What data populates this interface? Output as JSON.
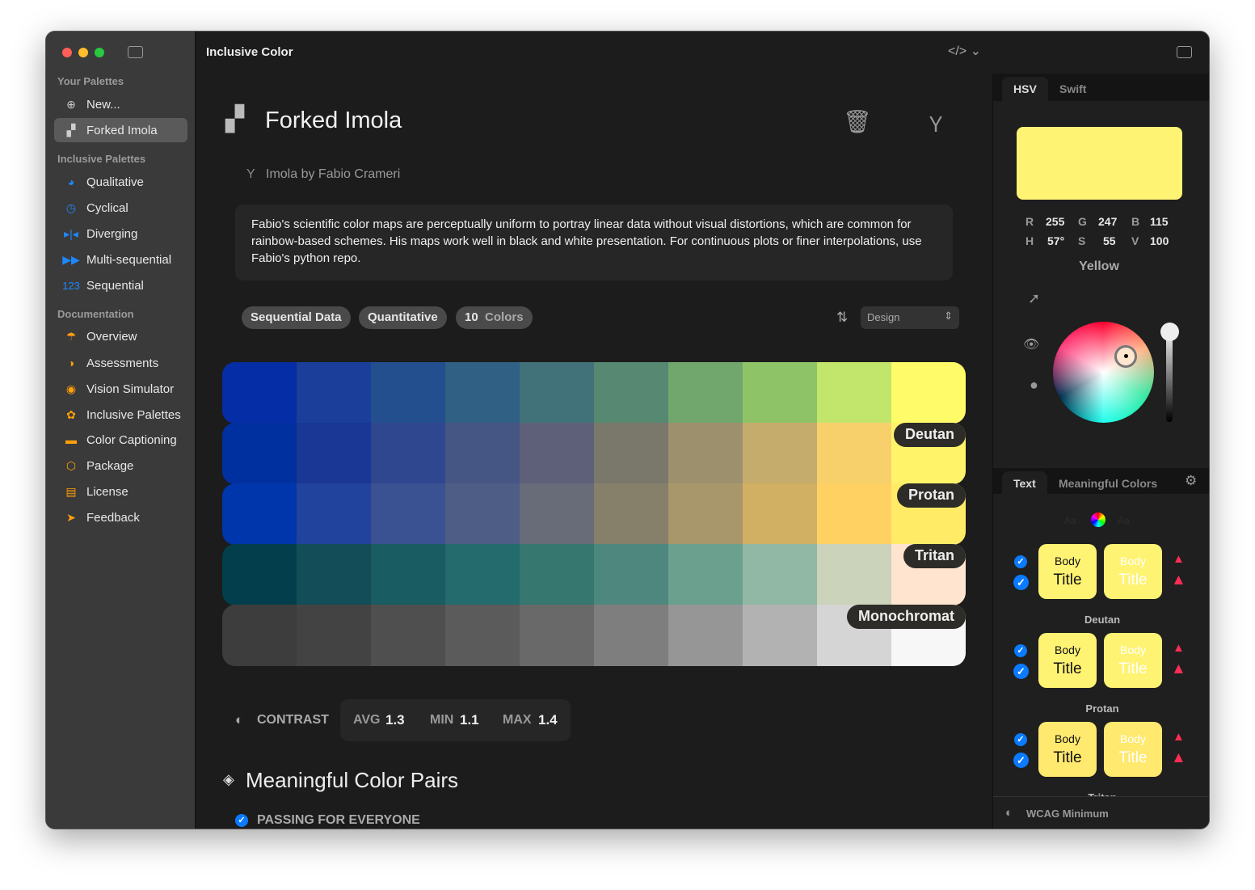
{
  "app": {
    "title": "Inclusive Color"
  },
  "sidebar": {
    "sections": [
      {
        "label": "Your Palettes",
        "items": [
          {
            "label": "New...",
            "icon": "plus-circle-icon"
          },
          {
            "label": "Forked Imola",
            "icon": "palette-fan-icon",
            "selected": true
          }
        ]
      },
      {
        "label": "Inclusive Palettes",
        "items": [
          {
            "label": "Qualitative",
            "icon": "pie-chart-icon"
          },
          {
            "label": "Cyclical",
            "icon": "clock-arrow-icon"
          },
          {
            "label": "Diverging",
            "icon": "diverging-arrows-icon"
          },
          {
            "label": "Multi-sequential",
            "icon": "forward-icon"
          },
          {
            "label": "Sequential",
            "icon": "123-icon",
            "icon_text": "123"
          }
        ]
      },
      {
        "label": "Documentation",
        "items": [
          {
            "label": "Overview",
            "icon": "umbrella-icon"
          },
          {
            "label": "Assessments",
            "icon": "contrast-icon"
          },
          {
            "label": "Vision Simulator",
            "icon": "eye-icon"
          },
          {
            "label": "Inclusive Palettes",
            "icon": "palette-icon"
          },
          {
            "label": "Color Captioning",
            "icon": "caption-icon"
          },
          {
            "label": "Package",
            "icon": "box-icon"
          },
          {
            "label": "License",
            "icon": "document-icon"
          },
          {
            "label": "Feedback",
            "icon": "paper-plane-icon"
          }
        ]
      }
    ]
  },
  "palette": {
    "title": "Forked Imola",
    "source": "Imola by Fabio Crameri",
    "description": "Fabio's scientific color maps are perceptually uniform to portray linear data without visual distortions, which are common for rainbow-based schemes. His maps work well in black and white presentation. For continuous plots or finer interpolations, use Fabio's python repo.",
    "tags": [
      "Sequential Data",
      "Quantitative"
    ],
    "count": "10",
    "count_label": "Colors",
    "sort_select": "Design",
    "rows": [
      {
        "name": "",
        "colors": [
          "#052da5",
          "#1a3e9a",
          "#234f8f",
          "#306084",
          "#41727a",
          "#568872",
          "#71a66c",
          "#8fc367",
          "#c2e56b",
          "#fffb69"
        ]
      },
      {
        "name": "Deutan",
        "colors": [
          "#0030a0",
          "#1a3795",
          "#2f478f",
          "#455584",
          "#5d6078",
          "#7a776b",
          "#9d916d",
          "#c5ab6c",
          "#f7d06b",
          "#fff469"
        ]
      },
      {
        "name": "Protan",
        "colors": [
          "#0036ab",
          "#21439e",
          "#3a5192",
          "#4e5d86",
          "#676c78",
          "#86806b",
          "#a8976a",
          "#d1af63",
          "#ffd163",
          "#ffeb66"
        ]
      },
      {
        "name": "Tritan",
        "colors": [
          "#023e4c",
          "#124d58",
          "#195c61",
          "#236b6c",
          "#367770",
          "#4e877e",
          "#6ba08f",
          "#91b8a4",
          "#cbd3bb",
          "#ffe5cf"
        ]
      },
      {
        "name": "Monochromat",
        "colors": [
          "#3d3d3d",
          "#434343",
          "#4f4f4f",
          "#5b5b5b",
          "#696969",
          "#7e7e7e",
          "#969696",
          "#b2b2b2",
          "#d5d5d5",
          "#f7f7f7"
        ]
      }
    ],
    "contrast": {
      "label": "CONTRAST",
      "avg_label": "AVG",
      "avg": "1.3",
      "min_label": "MIN",
      "min": "1.1",
      "max_label": "MAX",
      "max": "1.4"
    },
    "pairs_title": "Meaningful Color Pairs",
    "pairs_status": "PASSING FOR EVERYONE"
  },
  "inspector": {
    "tabs": [
      "HSV",
      "Swift"
    ],
    "swatch": "#fff373",
    "rgb": {
      "r": "255",
      "g": "247",
      "b": "115"
    },
    "hsv": {
      "h": "57°",
      "s": "55",
      "v": "100"
    },
    "color_name": "Yellow",
    "brightness": 1.0,
    "text_tabs": [
      "Text",
      "Meaningful Colors"
    ],
    "aa_label": "Aa",
    "card_body": "Body",
    "card_title": "Title",
    "groups": [
      {
        "name": "",
        "bg": "#fff373"
      },
      {
        "name": "Deutan",
        "bg": "#fff373"
      },
      {
        "name": "Protan",
        "bg": "#ffe96e"
      },
      {
        "name": "Tritan",
        "bg": "#ffe2cf"
      }
    ],
    "footer": "WCAG Minimum"
  }
}
